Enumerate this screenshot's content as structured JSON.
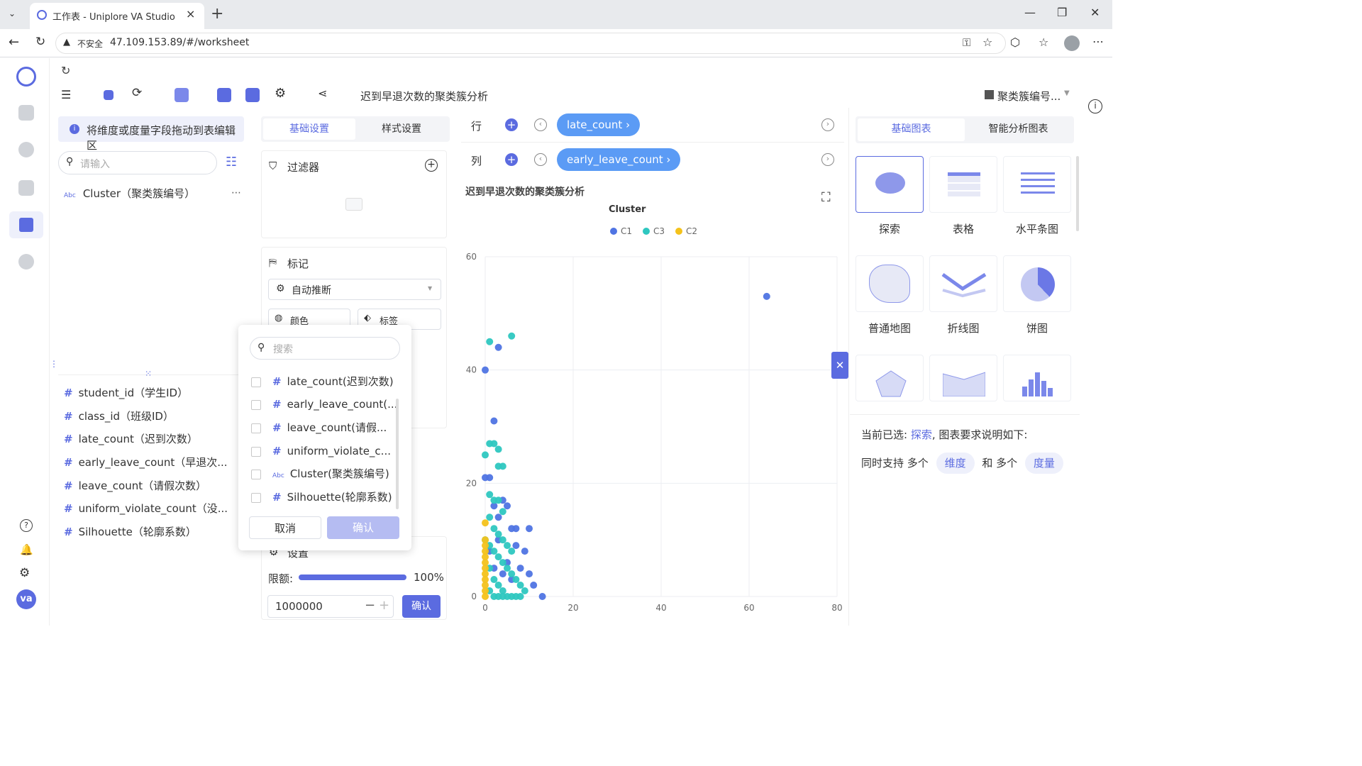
{
  "browser": {
    "tab_title": "工作表 - Uniplore VA Studio",
    "security_label": "不安全",
    "url": "47.109.153.89/#/worksheet"
  },
  "toolbar": {
    "sheet_title": "迟到早退次数的聚类簇分析",
    "dataset_label": "聚类簇编号..."
  },
  "left_panel": {
    "hint": "将维度或度量字段拖动到表编辑区",
    "search_placeholder": "请输入",
    "dimensions": [
      {
        "type": "Abc",
        "label": "Cluster（聚类簇编号）"
      }
    ],
    "measures": [
      {
        "label": "student_id（学生ID）"
      },
      {
        "label": "class_id（班级ID）"
      },
      {
        "label": "late_count（迟到次数）"
      },
      {
        "label": "early_leave_count（早退次..."
      },
      {
        "label": "leave_count（请假次数）"
      },
      {
        "label": "uniform_violate_count（没..."
      },
      {
        "label": "Silhouette（轮廓系数）"
      }
    ]
  },
  "settings_panel": {
    "tabs": [
      "基础设置",
      "样式设置"
    ],
    "filter_label": "过滤器",
    "marks_label": "标记",
    "auto_infer": "自动推断",
    "color_label": "颜色",
    "label_label": "标签",
    "settings_label": "设置",
    "limit_label": "限额:",
    "limit_percent": "100%",
    "limit_value": "1000000",
    "confirm": "确认"
  },
  "shelves": {
    "row_label": "行",
    "row_pill": "late_count",
    "col_label": "列",
    "col_pill": "early_leave_count"
  },
  "dropdown": {
    "search_placeholder": "搜索",
    "items": [
      {
        "type": "#",
        "label": "late_count(迟到次数)"
      },
      {
        "type": "#",
        "label": "early_leave_count(..."
      },
      {
        "type": "#",
        "label": "leave_count(请假..."
      },
      {
        "type": "#",
        "label": "uniform_violate_c..."
      },
      {
        "type": "Abc",
        "label": "Cluster(聚类簇编号)"
      },
      {
        "type": "#",
        "label": "Silhouette(轮廓系数)"
      }
    ],
    "cancel": "取消",
    "confirm": "确认"
  },
  "chart_panel": {
    "tabs": [
      "基础图表",
      "智能分析图表"
    ],
    "cards": [
      "探索",
      "表格",
      "水平条图",
      "普通地图",
      "折线图",
      "饼图"
    ],
    "current_selected_prefix": "当前已选:",
    "current_selected_value": "探索",
    "current_selected_suffix": ", 图表要求说明如下:",
    "support_text_1": "同时支持 多个",
    "support_tag_1": "维度",
    "support_text_2": "和 多个",
    "support_tag_2": "度量"
  },
  "colors": {
    "accent": "#5b6be0",
    "pill": "#5b9bf5",
    "C1": "#4f74e3",
    "C3": "#2ec7c0",
    "C2": "#f4c21b"
  },
  "chart_data": {
    "type": "scatter",
    "title": "迟到早退次数的聚类簇分析",
    "legend_title": "Cluster",
    "legend_position": "top-center",
    "xlim": [
      0,
      80
    ],
    "ylim": [
      0,
      60
    ],
    "x_ticks": [
      "0",
      "20",
      "40",
      "60",
      "80"
    ],
    "y_ticks": [
      "0",
      "20",
      "40",
      "60"
    ],
    "grid": true,
    "series": [
      {
        "name": "C1",
        "color": "#4f74e3",
        "points": [
          [
            64,
            53
          ],
          [
            0,
            40
          ],
          [
            3,
            44
          ],
          [
            2,
            31
          ],
          [
            0,
            21
          ],
          [
            1,
            21
          ],
          [
            4,
            17
          ],
          [
            5,
            16
          ],
          [
            3,
            14
          ],
          [
            2,
            16
          ],
          [
            6,
            12
          ],
          [
            7,
            12
          ],
          [
            10,
            12
          ],
          [
            7,
            9
          ],
          [
            9,
            8
          ],
          [
            5,
            6
          ],
          [
            8,
            5
          ],
          [
            10,
            4
          ],
          [
            6,
            3
          ],
          [
            11,
            2
          ],
          [
            13,
            0
          ],
          [
            3,
            10
          ],
          [
            1,
            8
          ],
          [
            2,
            5
          ],
          [
            4,
            4
          ]
        ]
      },
      {
        "name": "C3",
        "color": "#2ec7c0",
        "points": [
          [
            1,
            45
          ],
          [
            6,
            46
          ],
          [
            0,
            25
          ],
          [
            1,
            27
          ],
          [
            2,
            27
          ],
          [
            3,
            26
          ],
          [
            3,
            23
          ],
          [
            4,
            23
          ],
          [
            1,
            18
          ],
          [
            2,
            17
          ],
          [
            3,
            17
          ],
          [
            4,
            15
          ],
          [
            1,
            14
          ],
          [
            2,
            12
          ],
          [
            3,
            11
          ],
          [
            4,
            10
          ],
          [
            5,
            9
          ],
          [
            6,
            8
          ],
          [
            1,
            9
          ],
          [
            2,
            8
          ],
          [
            3,
            7
          ],
          [
            4,
            6
          ],
          [
            5,
            5
          ],
          [
            6,
            4
          ],
          [
            7,
            3
          ],
          [
            8,
            2
          ],
          [
            9,
            1
          ],
          [
            2,
            3
          ],
          [
            3,
            2
          ],
          [
            4,
            1
          ],
          [
            5,
            0
          ],
          [
            6,
            0
          ],
          [
            7,
            0
          ],
          [
            8,
            0
          ],
          [
            1,
            1
          ],
          [
            2,
            0
          ],
          [
            3,
            0
          ],
          [
            4,
            0
          ],
          [
            1,
            5
          ],
          [
            0,
            10
          ]
        ]
      },
      {
        "name": "C2",
        "color": "#f4c21b",
        "points": [
          [
            0,
            13
          ],
          [
            0,
            10
          ],
          [
            0,
            8
          ],
          [
            0,
            6
          ],
          [
            0,
            5
          ],
          [
            0,
            4
          ],
          [
            0,
            3
          ],
          [
            0,
            2
          ],
          [
            0,
            1
          ],
          [
            0,
            0
          ],
          [
            0,
            7
          ],
          [
            0,
            9
          ]
        ]
      }
    ]
  }
}
